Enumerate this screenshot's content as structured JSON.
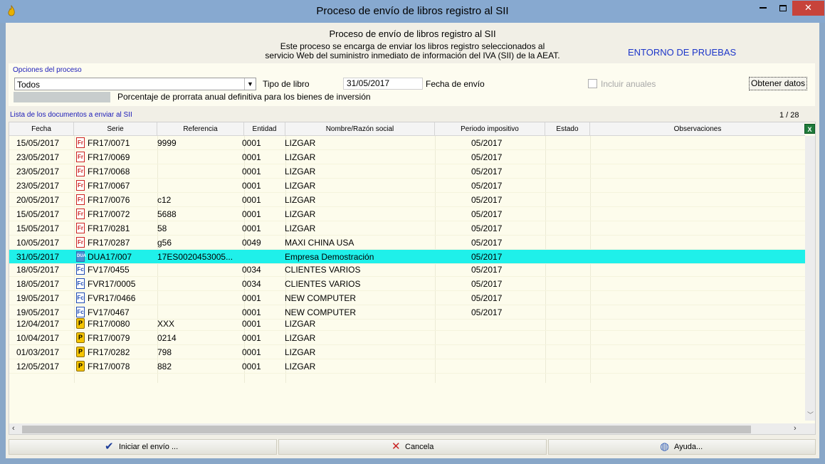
{
  "window": {
    "title": "Proceso de envío de libros registro al SII"
  },
  "header": {
    "title": "Proceso de envío de libros registro al SII",
    "description_line1": "Este proceso se encarga de enviar los libros registro seleccionados al",
    "description_line2": "servicio Web del suministro inmediato de información del IVA (SII) de la AEAT.",
    "environment": "ENTORNO DE PRUEBAS",
    "environment_color": "#1d36c9"
  },
  "options": {
    "group_label": "Opciones del proceso",
    "book_type_value": "Todos",
    "book_type_label": "Tipo de libro",
    "send_date_value": "31/05/2017",
    "send_date_label": "Fecha de envío",
    "include_annual_label": "Incluir anuales",
    "include_annual_checked": false,
    "fetch_button": "Obtener datos",
    "prorrata_label": "Porcentaje de prorrata anual definitiva para los bienes de inversión"
  },
  "list": {
    "title": "Lista de los documentos a enviar al SII",
    "page_indicator": "1 / 28",
    "columns": [
      "Fecha",
      "Serie",
      "Referencia",
      "Entidad",
      "Nombre/Razón social",
      "Periodo impositivo",
      "Estado",
      "Observaciones"
    ],
    "selected_row_color": "#1ff0ea",
    "rows": [
      {
        "fecha": "15/05/2017",
        "icon": "fr",
        "serie": "FR17/0071",
        "referencia": "9999",
        "entidad": "0001",
        "nombre": "LIZGAR",
        "periodo": "05/2017"
      },
      {
        "fecha": "23/05/2017",
        "icon": "fr",
        "serie": "FR17/0069",
        "referencia": "",
        "entidad": "0001",
        "nombre": "LIZGAR",
        "periodo": "05/2017"
      },
      {
        "fecha": "23/05/2017",
        "icon": "fr",
        "serie": "FR17/0068",
        "referencia": "",
        "entidad": "0001",
        "nombre": "LIZGAR",
        "periodo": "05/2017"
      },
      {
        "fecha": "23/05/2017",
        "icon": "fr",
        "serie": "FR17/0067",
        "referencia": "",
        "entidad": "0001",
        "nombre": "LIZGAR",
        "periodo": "05/2017"
      },
      {
        "fecha": "20/05/2017",
        "icon": "fr",
        "serie": "FR17/0076",
        "referencia": "c12",
        "entidad": "0001",
        "nombre": "LIZGAR",
        "periodo": "05/2017"
      },
      {
        "fecha": "15/05/2017",
        "icon": "fr",
        "serie": "FR17/0072",
        "referencia": "5688",
        "entidad": "0001",
        "nombre": "LIZGAR",
        "periodo": "05/2017"
      },
      {
        "fecha": "15/05/2017",
        "icon": "fr",
        "serie": "FR17/0281",
        "referencia": "58",
        "entidad": "0001",
        "nombre": "LIZGAR",
        "periodo": "05/2017"
      },
      {
        "fecha": "10/05/2017",
        "icon": "fr",
        "serie": "FR17/0287",
        "referencia": "g56",
        "entidad": "0049",
        "nombre": "MAXI CHINA USA",
        "periodo": "05/2017"
      },
      {
        "fecha": "31/05/2017",
        "icon": "dua",
        "serie": "DUA17/007",
        "referencia": "17ES0020453005...",
        "entidad": "",
        "nombre": "Empresa Demostración",
        "periodo": "05/2017",
        "selected": true
      },
      {
        "fecha": "18/05/2017",
        "icon": "fv",
        "serie": "FV17/0455",
        "referencia": "",
        "entidad": "0034",
        "nombre": "CLIENTES VARIOS",
        "periodo": "05/2017"
      },
      {
        "fecha": "18/05/2017",
        "icon": "fv",
        "serie": "FVR17/0005",
        "referencia": "",
        "entidad": "0034",
        "nombre": "CLIENTES VARIOS",
        "periodo": "05/2017"
      },
      {
        "fecha": "19/05/2017",
        "icon": "fv",
        "serie": "FVR17/0466",
        "referencia": "",
        "entidad": "0001",
        "nombre": "NEW COMPUTER",
        "periodo": "05/2017"
      },
      {
        "fecha": "19/05/2017",
        "icon": "fv",
        "serie": "FV17/0467",
        "referencia": "",
        "entidad": "0001",
        "nombre": "NEW COMPUTER",
        "periodo": "05/2017"
      },
      {
        "fecha": "12/04/2017",
        "icon": "p",
        "serie": "FR17/0080",
        "referencia": "XXX",
        "entidad": "0001",
        "nombre": "LIZGAR",
        "periodo": ""
      },
      {
        "fecha": "10/04/2017",
        "icon": "p",
        "serie": "FR17/0079",
        "referencia": "0214",
        "entidad": "0001",
        "nombre": "LIZGAR",
        "periodo": ""
      },
      {
        "fecha": "01/03/2017",
        "icon": "p",
        "serie": "FR17/0282",
        "referencia": "798",
        "entidad": "0001",
        "nombre": "LIZGAR",
        "periodo": ""
      },
      {
        "fecha": "12/05/2017",
        "icon": "p",
        "serie": "FR17/0078",
        "referencia": "882",
        "entidad": "0001",
        "nombre": "LIZGAR",
        "periodo": ""
      }
    ]
  },
  "buttons": {
    "start": "Iniciar el envío ...",
    "cancel": "Cancela",
    "help": "Ayuda..."
  }
}
